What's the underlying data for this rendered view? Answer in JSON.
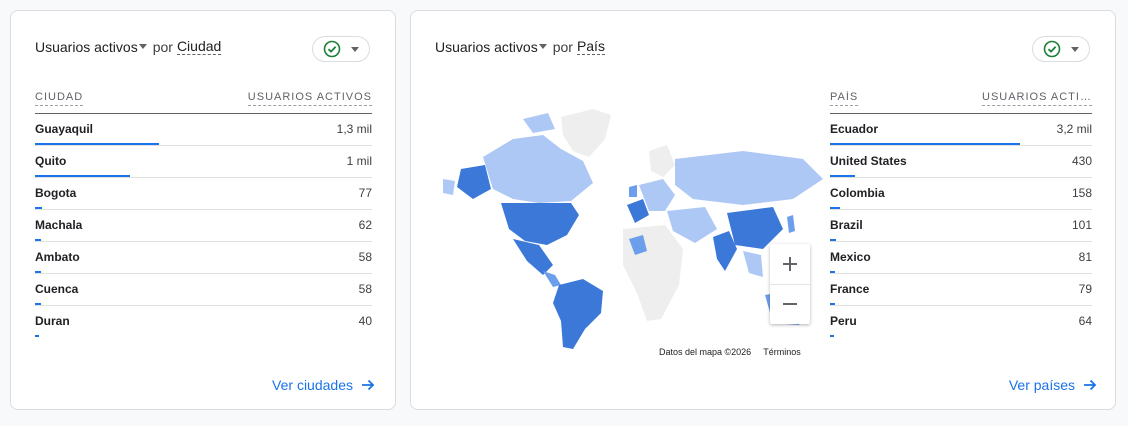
{
  "city_card": {
    "metric": "Usuarios activos",
    "por": "por",
    "dimension": "Ciudad",
    "col_left": "CIUDAD",
    "col_right": "USUARIOS ACTIVOS",
    "rows": [
      {
        "label": "Guayaquil",
        "value": "1,3 mil",
        "share": 1.0
      },
      {
        "label": "Quito",
        "value": "1 mil",
        "share": 0.77
      },
      {
        "label": "Bogota",
        "value": "77",
        "share": 0.06
      },
      {
        "label": "Machala",
        "value": "62",
        "share": 0.05
      },
      {
        "label": "Ambato",
        "value": "58",
        "share": 0.045
      },
      {
        "label": "Cuenca",
        "value": "58",
        "share": 0.045
      },
      {
        "label": "Duran",
        "value": "40",
        "share": 0.03
      }
    ],
    "footer_link": "Ver ciudades"
  },
  "country_card": {
    "metric": "Usuarios activos",
    "por": "por",
    "dimension": "País",
    "col_left": "PAÍS",
    "col_right": "USUARIOS ACTIVOS",
    "rows": [
      {
        "label": "Ecuador",
        "value": "3,2 mil",
        "share": 1.0
      },
      {
        "label": "United States",
        "value": "430",
        "share": 0.134
      },
      {
        "label": "Colombia",
        "value": "158",
        "share": 0.05
      },
      {
        "label": "Brazil",
        "value": "101",
        "share": 0.032
      },
      {
        "label": "Mexico",
        "value": "81",
        "share": 0.025
      },
      {
        "label": "France",
        "value": "79",
        "share": 0.025
      },
      {
        "label": "Peru",
        "value": "64",
        "share": 0.02
      }
    ],
    "footer_link": "Ver países",
    "map": {
      "credit": "Datos del mapa ©2026",
      "terms": "Términos",
      "zoom_in": "+",
      "zoom_out": "−"
    }
  },
  "colors": {
    "accent": "#1a73e8",
    "check_green": "#188038",
    "map_high": "#3b78d8",
    "map_mid": "#6d9eeb",
    "map_low": "#aec8f5",
    "map_none": "#eeeeee"
  }
}
